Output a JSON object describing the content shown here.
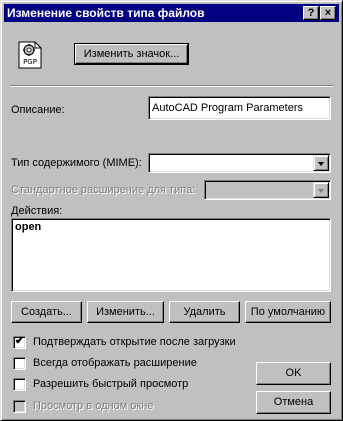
{
  "window": {
    "title": "Изменение свойств типа файлов",
    "help_glyph": "?",
    "close_glyph": "×"
  },
  "icon": {
    "name": "pgp-file-icon",
    "caption": "PGP"
  },
  "change_icon_button": "Изменить значок...",
  "description": {
    "label": "Описание:",
    "value": "AutoCAD Program Parameters"
  },
  "mime": {
    "label": "Тип содержимого (MIME):",
    "value": ""
  },
  "default_extension": {
    "label": "Стандартное расширение для типа:",
    "value": ""
  },
  "actions": {
    "label": "Действия:",
    "items": [
      "open"
    ]
  },
  "action_buttons": {
    "new": "Создать...",
    "edit": "Изменить...",
    "remove": "Удалить",
    "set_default": "По умолчанию"
  },
  "options": {
    "confirm_open": {
      "label": "Подтверждать открытие после загрузки",
      "checked": true
    },
    "always_show_ext": {
      "label": "Всегда отображать расширение",
      "checked": false
    },
    "quick_view": {
      "label": "Разрешить быстрый просмотр",
      "checked": false
    },
    "browse_same_window": {
      "label": "Просмотр в одном окне",
      "checked": false,
      "disabled": true
    }
  },
  "ok_button": "OK",
  "cancel_button": "Отмена"
}
